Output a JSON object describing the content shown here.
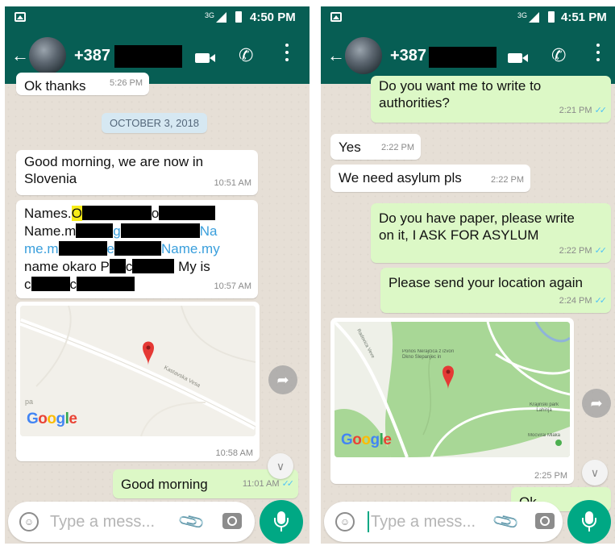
{
  "colors": {
    "header": "#075e54",
    "incoming": "#ffffff",
    "outgoing": "#dcf8c6",
    "ticks": "#4fc3f7",
    "mic": "#00a884"
  },
  "left": {
    "status_time": "4:50 PM",
    "network": "3G",
    "contact": "+387",
    "date_chip": "OCTOBER 3, 2018",
    "partial_msg": {
      "text": "Ok thanks",
      "time": "5:26 PM"
    },
    "msg1": {
      "line1": "Good morning, we are now in",
      "line2": "Slovenia",
      "time": "10:51 AM"
    },
    "msg2": {
      "l1a": "Names.",
      "l1b": "O",
      "l1c": "o",
      "l2a": "Name.m",
      "l2b": "g",
      "l2c": "Na",
      "l3a": "me.m",
      "l3b": "e",
      "l3c": "Name.my",
      "l4a": "name okaro P",
      "l4b": "c",
      "l4c": "My is",
      "l5a": "c",
      "l5b": "c",
      "time": "10:57 AM"
    },
    "map_card": {
      "street": "Kastavska Vesa",
      "pa_label": "pa",
      "time": "10:58 AM"
    },
    "msg3": {
      "text": "Good morning",
      "time": "11:01 AM"
    },
    "input_placeholder": "Type a mess..."
  },
  "right": {
    "status_time": "4:51 PM",
    "network": "3G",
    "contact": "+387",
    "msg1": {
      "line1": "Do you want me to write to",
      "line2": "authorities?",
      "time": "2:21 PM"
    },
    "msg2": {
      "text": "Yes",
      "time": "2:22 PM"
    },
    "msg3": {
      "text": "We need asylum pls",
      "time": "2:22 PM"
    },
    "msg4": {
      "line1": "Do you have paper, please write",
      "line2": "on it, I ASK FOR ASYLUM",
      "time": "2:22 PM"
    },
    "msg5": {
      "text": "Please send your location again",
      "time": "2:24 PM"
    },
    "map_card": {
      "place": "Ponos Nerajčica z izvori Dkno Slepanjec in",
      "park": "Krajinski park Lahinja",
      "place2": "Mocvirai Mlaka",
      "road_label": "Radovica Veve",
      "time": "2:25 PM"
    },
    "partial_msg": "Ok",
    "input_placeholder": "Type a mess..."
  },
  "icons": [
    "back-arrow-icon",
    "video-call-icon",
    "phone-call-icon",
    "more-menu-icon",
    "emoji-icon",
    "attach-icon",
    "camera-icon",
    "mic-icon",
    "share-icon",
    "scroll-down-icon",
    "map-pin-icon",
    "double-check-icon"
  ]
}
